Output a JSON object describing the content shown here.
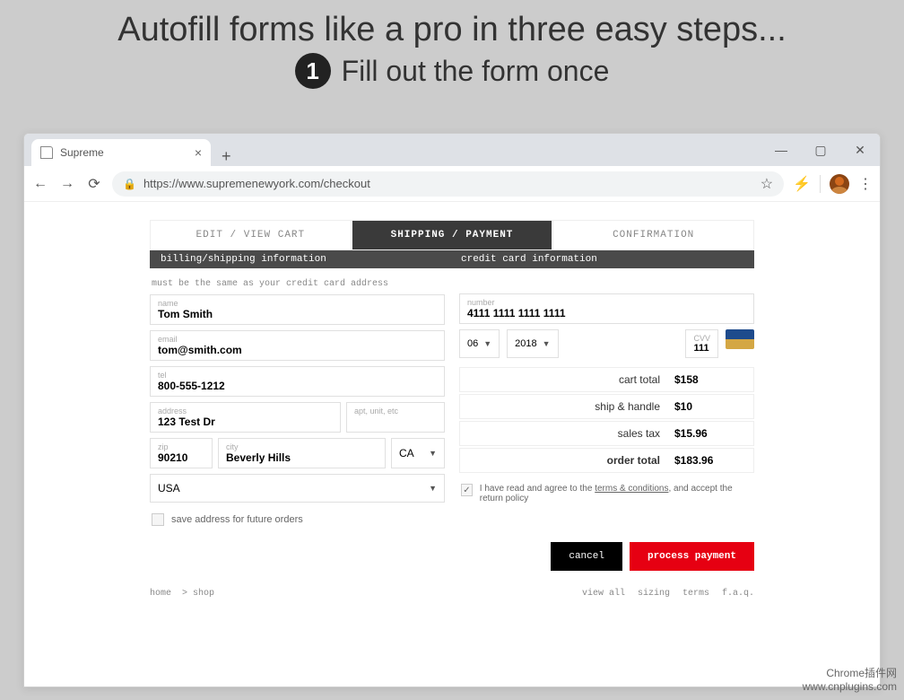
{
  "hero": {
    "title": "Autofill forms like a pro in three easy steps...",
    "step_number": "1",
    "subtitle": "Fill out the form once"
  },
  "browser": {
    "tab_title": "Supreme",
    "url": "https://www.supremenewyork.com/checkout"
  },
  "checkout_tabs": {
    "edit_cart": "EDIT / VIEW CART",
    "shipping": "SHIPPING / PAYMENT",
    "confirmation": "CONFIRMATION"
  },
  "section_headers": {
    "billing": "billing/shipping information",
    "credit": "credit card information"
  },
  "billing": {
    "helper": "must be the same as your credit card address",
    "name_label": "name",
    "name_value": "Tom Smith",
    "email_label": "email",
    "email_value": "tom@smith.com",
    "tel_label": "tel",
    "tel_value": "800-555-1212",
    "address_label": "address",
    "address_value": "123 Test Dr",
    "apt_label": "apt, unit, etc",
    "zip_label": "zip",
    "zip_value": "90210",
    "city_label": "city",
    "city_value": "Beverly Hills",
    "state": "CA",
    "country": "USA",
    "save_address": "save address for future orders"
  },
  "credit": {
    "number_label": "number",
    "number_value": "4111 1111 1111 1111",
    "month": "06",
    "year": "2018",
    "cvv_label": "CVV",
    "cvv_value": "111"
  },
  "totals": {
    "cart_label": "cart total",
    "cart_value": "$158",
    "ship_label": "ship & handle",
    "ship_value": "$10",
    "tax_label": "sales tax",
    "tax_value": "$15.96",
    "order_label": "order total",
    "order_value": "$183.96"
  },
  "terms": {
    "text_before": "I have read and agree to the ",
    "link": "terms & conditions",
    "text_after": ", and accept the return policy"
  },
  "buttons": {
    "cancel": "cancel",
    "process": "process payment"
  },
  "footer": {
    "home": "home",
    "shop": "> shop",
    "view_all": "view all",
    "sizing": "sizing",
    "terms": "terms",
    "faq": "f.a.q."
  },
  "watermark": {
    "line1": "Chrome插件网",
    "line2": "www.cnplugins.com"
  }
}
